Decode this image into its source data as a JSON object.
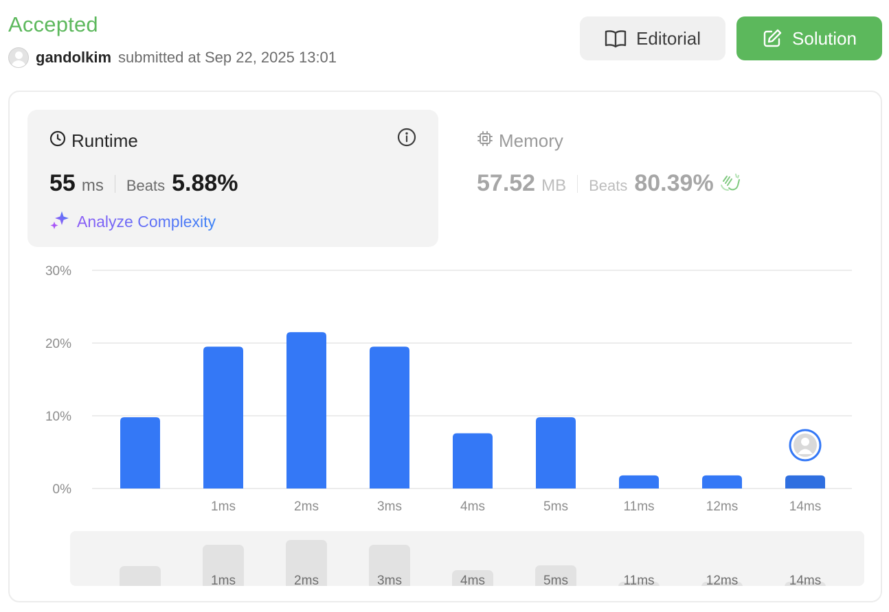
{
  "submission": {
    "status": "Accepted",
    "username": "gandolkim",
    "submitted_text": "submitted at Sep 22, 2025 13:01"
  },
  "buttons": {
    "editorial": "Editorial",
    "solution": "Solution"
  },
  "runtime": {
    "title": "Runtime",
    "value": "55",
    "unit": "ms",
    "beats_label": "Beats",
    "beats_value": "5.88%",
    "analyze_label": "Analyze Complexity"
  },
  "memory": {
    "title": "Memory",
    "value": "57.52",
    "unit": "MB",
    "beats_label": "Beats",
    "beats_value": "80.39%"
  },
  "colors": {
    "accepted": "#5cb85c",
    "bar": "#3478f6",
    "bar_highlight": "#2f6fe0",
    "overview_bar": "#e2e2e2"
  },
  "chart_data": {
    "type": "bar",
    "categories": [
      "",
      "1ms",
      "2ms",
      "3ms",
      "4ms",
      "5ms",
      "11ms",
      "12ms",
      "14ms"
    ],
    "values": [
      9.8,
      19.5,
      21.5,
      19.5,
      7.6,
      9.8,
      1.8,
      1.8,
      1.8
    ],
    "yticks": [
      "0%",
      "10%",
      "20%",
      "30%"
    ],
    "ylim": [
      0,
      30
    ],
    "grid": true,
    "highlight_index": 8,
    "overview_values": [
      2.9,
      6.0,
      6.7,
      6.0,
      2.3,
      3.0,
      0.6,
      0.6,
      0.6
    ]
  }
}
